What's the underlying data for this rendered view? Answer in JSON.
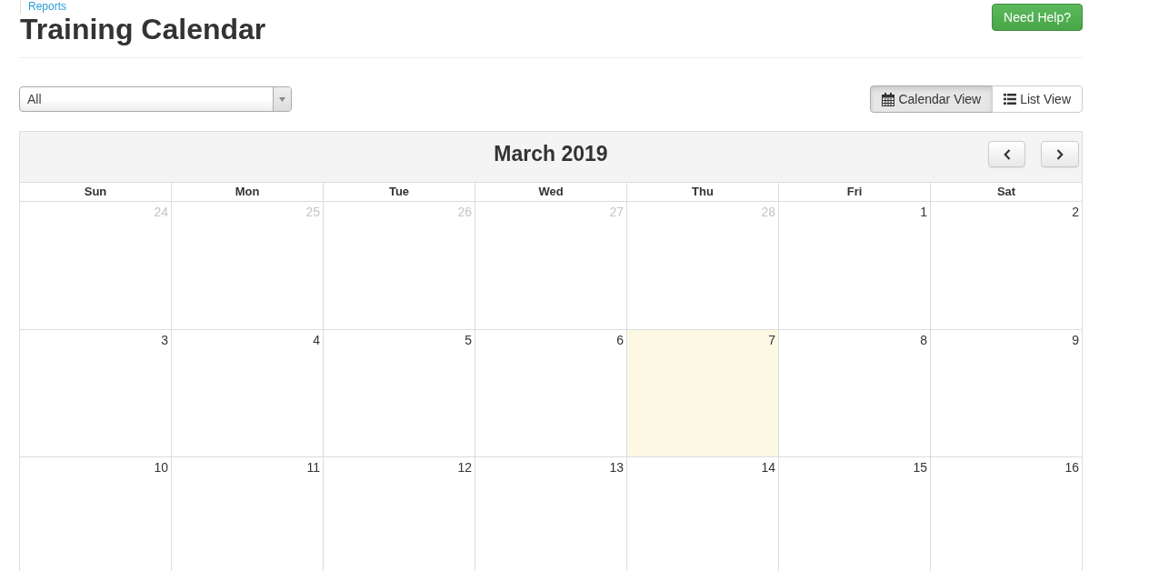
{
  "breadcrumb": {
    "label": "Reports"
  },
  "page_title": "Training Calendar",
  "help_button": {
    "label": "Need Help?"
  },
  "filter": {
    "value": "All"
  },
  "view_tabs": [
    {
      "label": "Calendar View",
      "kind": "calendar",
      "selected": true
    },
    {
      "label": "List View",
      "kind": "list",
      "selected": false
    }
  ],
  "calendar": {
    "title": "March 2019",
    "weekdays": [
      "Sun",
      "Mon",
      "Tue",
      "Wed",
      "Thu",
      "Fri",
      "Sat"
    ],
    "weeks": [
      {
        "days": [
          {
            "label": "24",
            "other_month": true,
            "today": false
          },
          {
            "label": "25",
            "other_month": true,
            "today": false
          },
          {
            "label": "26",
            "other_month": true,
            "today": false
          },
          {
            "label": "27",
            "other_month": true,
            "today": false
          },
          {
            "label": "28",
            "other_month": true,
            "today": false
          },
          {
            "label": "1",
            "other_month": false,
            "today": false
          },
          {
            "label": "2",
            "other_month": false,
            "today": false
          }
        ]
      },
      {
        "days": [
          {
            "label": "3",
            "other_month": false,
            "today": false
          },
          {
            "label": "4",
            "other_month": false,
            "today": false
          },
          {
            "label": "5",
            "other_month": false,
            "today": false
          },
          {
            "label": "6",
            "other_month": false,
            "today": false
          },
          {
            "label": "7",
            "other_month": false,
            "today": true
          },
          {
            "label": "8",
            "other_month": false,
            "today": false
          },
          {
            "label": "9",
            "other_month": false,
            "today": false
          }
        ]
      },
      {
        "days": [
          {
            "label": "10",
            "other_month": false,
            "today": false
          },
          {
            "label": "11",
            "other_month": false,
            "today": false
          },
          {
            "label": "12",
            "other_month": false,
            "today": false
          },
          {
            "label": "13",
            "other_month": false,
            "today": false
          },
          {
            "label": "14",
            "other_month": false,
            "today": false
          },
          {
            "label": "15",
            "other_month": false,
            "today": false
          },
          {
            "label": "16",
            "other_month": false,
            "today": false
          }
        ]
      }
    ]
  }
}
